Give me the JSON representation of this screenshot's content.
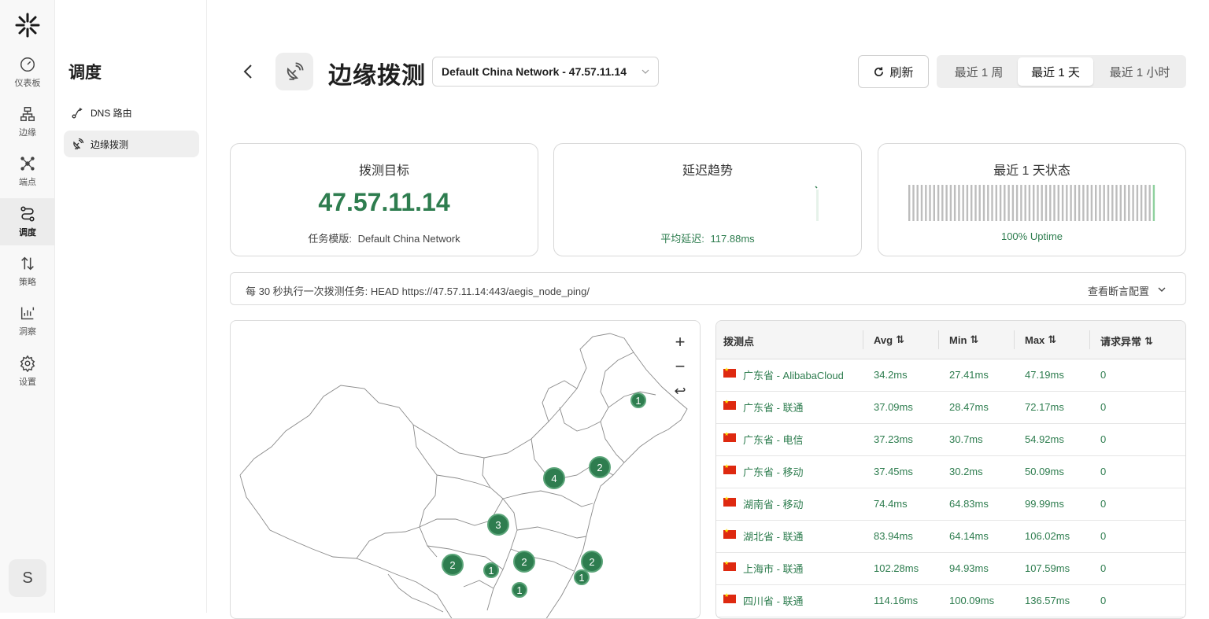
{
  "rail": {
    "items": [
      {
        "label": "仪表板",
        "icon": "gauge-icon"
      },
      {
        "label": "边缘",
        "icon": "network-icon"
      },
      {
        "label": "端点",
        "icon": "nodes-icon"
      },
      {
        "label": "调度",
        "icon": "route-icon"
      },
      {
        "label": "策略",
        "icon": "arrows-updown-icon"
      },
      {
        "label": "洞察",
        "icon": "chart-icon"
      },
      {
        "label": "设置",
        "icon": "gear-icon"
      }
    ],
    "active": "调度",
    "avatar": "S"
  },
  "sidebar": {
    "title": "调度",
    "items": [
      {
        "label": "DNS 路由",
        "icon": "route-arrow-icon"
      },
      {
        "label": "边缘拨测",
        "icon": "satellite-dish-icon"
      }
    ],
    "active": "边缘拨测"
  },
  "header": {
    "title": "边缘拨测",
    "selected_task": "Default China Network - 47.57.11.14",
    "refresh_label": "刷新",
    "ranges": [
      "最近 1 周",
      "最近 1 天",
      "最近 1 小时"
    ],
    "selected_range": "最近 1 天"
  },
  "cards": {
    "target": {
      "title": "拨测目标",
      "value": "47.57.11.14",
      "sub_label": "任务模版:",
      "sub_value": "Default China Network"
    },
    "latency": {
      "title": "延迟趋势",
      "sub_label": "平均延迟:",
      "sub_value": "117.88ms"
    },
    "status": {
      "title": "最近 1 天状态",
      "sub": "100% Uptime",
      "uptime_fraction": 1.0
    }
  },
  "info": {
    "text": "每 30 秒执行一次拨测任务: HEAD https://47.57.11.14:443/aegis_node_ping/",
    "link": "查看断言配置"
  },
  "map": {
    "controls": [
      "+",
      "−",
      "↩"
    ],
    "clusters": [
      "1",
      "4",
      "2",
      "3",
      "2",
      "1",
      "2",
      "2",
      "1",
      "1"
    ]
  },
  "table": {
    "columns": [
      "拨测点",
      "Avg",
      "Min",
      "Max",
      "请求异常"
    ],
    "rows": [
      {
        "name": "广东省 - AlibabaCloud",
        "avg": "34.2ms",
        "min": "27.41ms",
        "max": "47.19ms",
        "err": "0"
      },
      {
        "name": "广东省 - 联通",
        "avg": "37.09ms",
        "min": "28.47ms",
        "max": "72.17ms",
        "err": "0"
      },
      {
        "name": "广东省 - 电信",
        "avg": "37.23ms",
        "min": "30.7ms",
        "max": "54.92ms",
        "err": "0"
      },
      {
        "name": "广东省 - 移动",
        "avg": "37.45ms",
        "min": "30.2ms",
        "max": "50.09ms",
        "err": "0"
      },
      {
        "name": "湖南省 - 移动",
        "avg": "74.4ms",
        "min": "64.83ms",
        "max": "99.99ms",
        "err": "0"
      },
      {
        "name": "湖北省 - 联通",
        "avg": "83.94ms",
        "min": "64.14ms",
        "max": "106.02ms",
        "err": "0"
      },
      {
        "name": "上海市 - 联通",
        "avg": "102.28ms",
        "min": "94.93ms",
        "max": "107.59ms",
        "err": "0"
      },
      {
        "name": "四川省 - 联通",
        "avg": "114.16ms",
        "min": "100.09ms",
        "max": "136.57ms",
        "err": "0"
      }
    ]
  },
  "colors": {
    "accent": "#2e7d4f",
    "uptime_bar": "#bdbdbd",
    "uptime_bar_latest": "#8fd19e"
  }
}
